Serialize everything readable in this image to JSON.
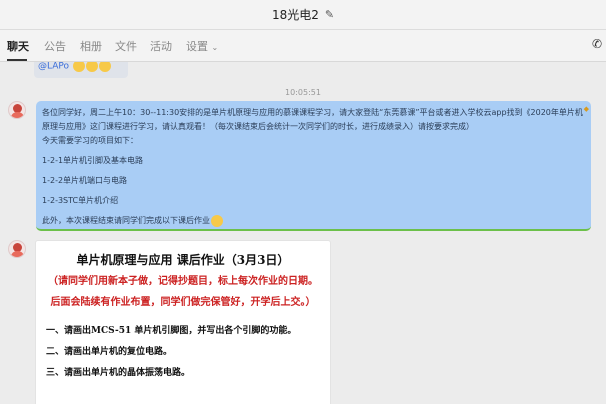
{
  "window": {
    "title": "18光电2",
    "edit_icon": "pencil-icon"
  },
  "tabs": [
    {
      "label": "聊天",
      "active": true
    },
    {
      "label": "公告",
      "active": false
    },
    {
      "label": "相册",
      "active": false
    },
    {
      "label": "文件",
      "active": false
    },
    {
      "label": "活动",
      "active": false
    },
    {
      "label": "设置",
      "active": false,
      "dropdown": true
    }
  ],
  "call_icon": "phone-icon",
  "previous_message": {
    "mention": "@LAPo",
    "emoji_icon": "clap-emoji-icon"
  },
  "timestamp": "10:05:51",
  "message": {
    "lines": [
      "各位同学好，周二上午10：30--11:30安排的是单片机原理与应用的慕课课程学习，请大家登陆“东莞慕课”平台或者进入学校云app找到《2020年单片机原理与应用》这门课程进行学习，请认真观看！（每次课结束后会统计一次同学们的时长，进行成绩录入）请按要求完成）",
      "今天需要学习的项目如下：",
      "1-2-1单片机引脚及基本电路",
      "1-2-2单片机端口与电路",
      "1-2-3STC单片机介绍",
      "此外，本次课程结束请同学们完成以下课后作业"
    ],
    "emoji_icon": "smile-emoji-icon",
    "accent": "#a9cdf5"
  },
  "card": {
    "title": "单片机原理与应用    课后作业（3月3日）",
    "note": "（请同学们用新本子做，记得抄题目，标上每次作业的日期。后面会陆续有作业布置，同学们做完保管好，开学后上交。）",
    "items": [
      "一、请画出MCS-51 单片机引脚图，并写出各个引脚的功能。",
      "二、请画出单片机的复位电路。",
      "三、请画出单片机的晶体振荡电路。"
    ],
    "note_color": "#cc2222"
  }
}
